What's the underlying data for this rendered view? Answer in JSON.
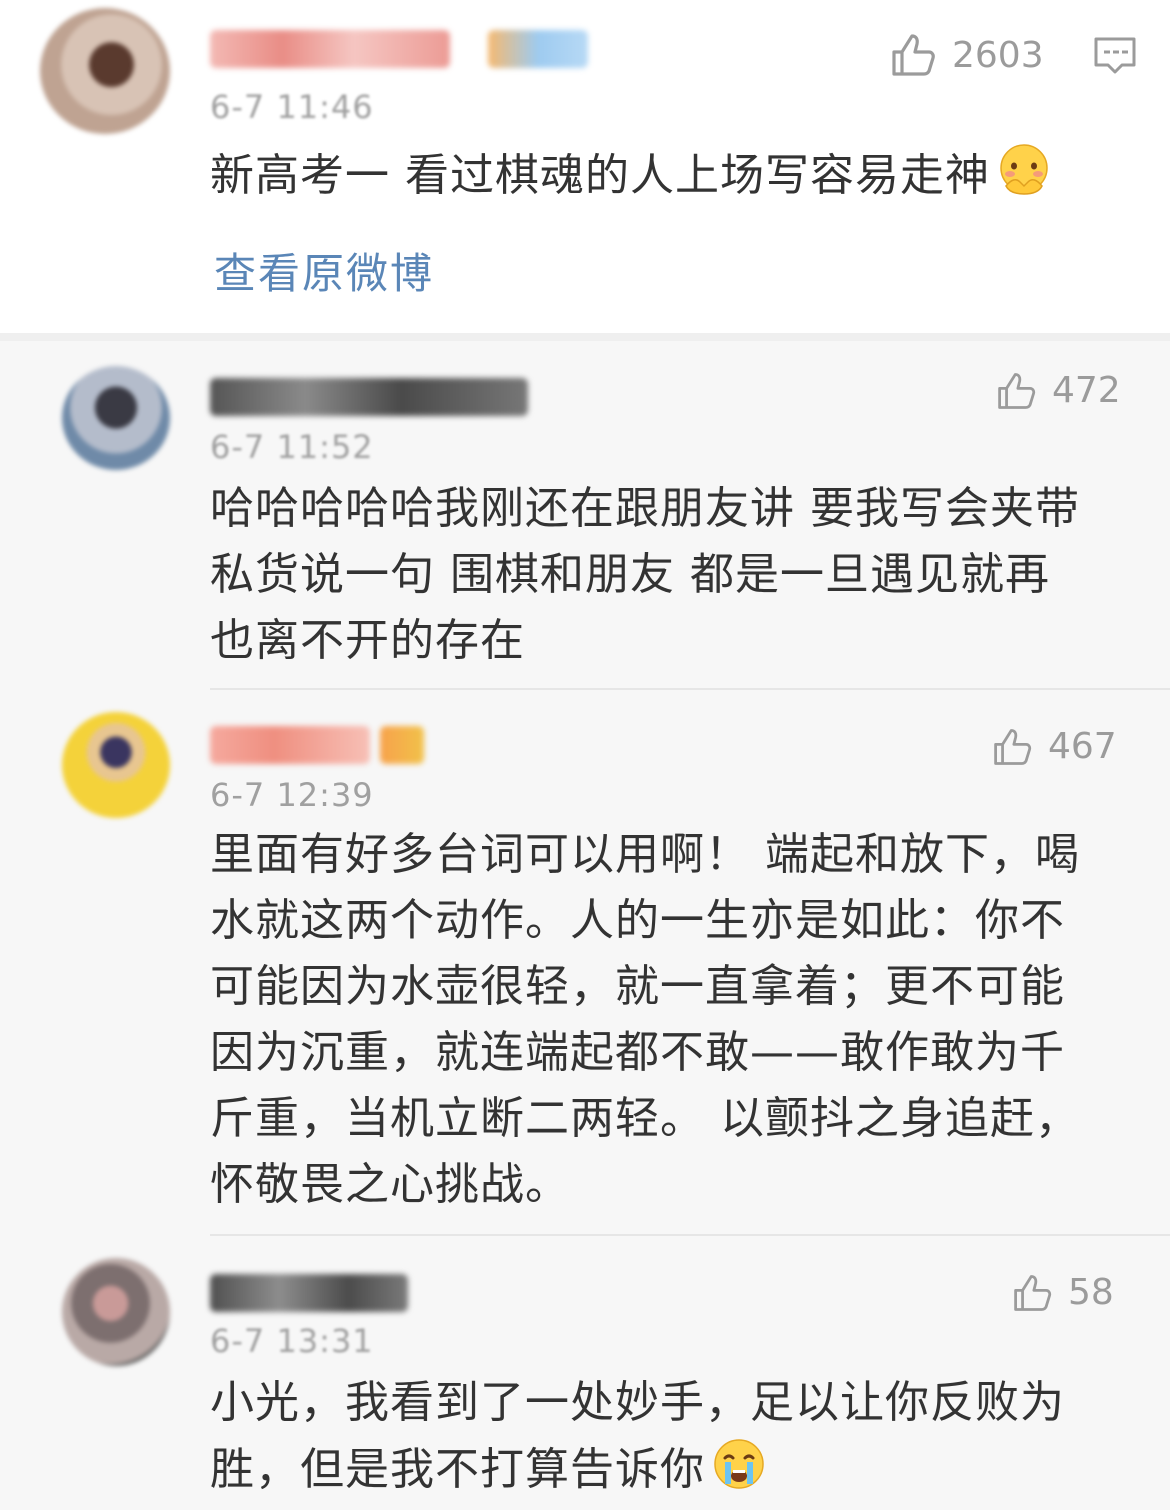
{
  "main_post": {
    "time": "6-7 11:46",
    "text": "新高考一 看过棋魂的人上场写容易走神",
    "like_count": "2603",
    "view_original": "查看原微博",
    "emoji": "blush-hands-emoji"
  },
  "replies": [
    {
      "time": "6-7 11:52",
      "likes": "472",
      "lines": [
        "哈哈哈哈哈我刚还在跟朋友讲 要我写会夹带",
        "私货说一句 围棋和朋友 都是一旦遇见就再",
        "也离不开的存在"
      ]
    },
    {
      "time": "6-7 12:39",
      "likes": "467",
      "lines": [
        "里面有好多台词可以用啊！ 端起和放下，喝",
        "水就这两个动作。人的一生亦是如此：你不",
        "可能因为水壶很轻，就一直拿着；更不可能",
        "因为沉重，就连端起都不敢——敢作敢为千",
        "斤重，当机立断二两轻。 以颤抖之身追赶，",
        "怀敬畏之心挑战。"
      ]
    },
    {
      "time": "6-7 13:31",
      "likes": "58",
      "lines": [
        "小光，我看到了一处妙手，足以让你反败为",
        "胜，但是我不打算告诉你"
      ],
      "emoji": "crying-face-emoji"
    }
  ],
  "colors": {
    "link": "#5a86b7",
    "meta": "#a0a0a0",
    "body_text": "#333333",
    "reply_bg": "#f7f7f7"
  }
}
